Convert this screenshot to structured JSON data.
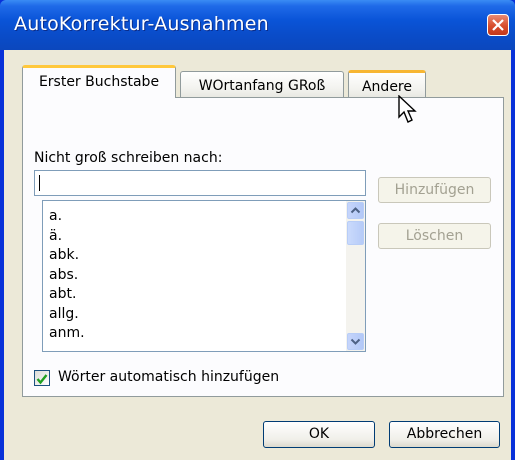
{
  "window": {
    "title": "AutoKorrektur-Ausnahmen"
  },
  "tabs": [
    {
      "label": "Erster Buchstabe",
      "active": true
    },
    {
      "label": "WOrtanfang GRoß",
      "active": false
    },
    {
      "label": "Andere",
      "active": false
    }
  ],
  "field_label": "Nicht groß schreiben nach:",
  "input_value": "",
  "list_items": [
    "a.",
    "ä.",
    "abk.",
    "abs.",
    "abt.",
    "allg.",
    "anm."
  ],
  "buttons": {
    "add": "Hinzufügen",
    "delete": "Löschen",
    "ok": "OK",
    "cancel": "Abbrechen"
  },
  "checkbox": {
    "label": "Wörter automatisch hinzufügen",
    "checked": true
  },
  "colors": {
    "titlebar": "#0a54d8",
    "dialog": "#ece9d8",
    "checkmark": "#21a121"
  }
}
